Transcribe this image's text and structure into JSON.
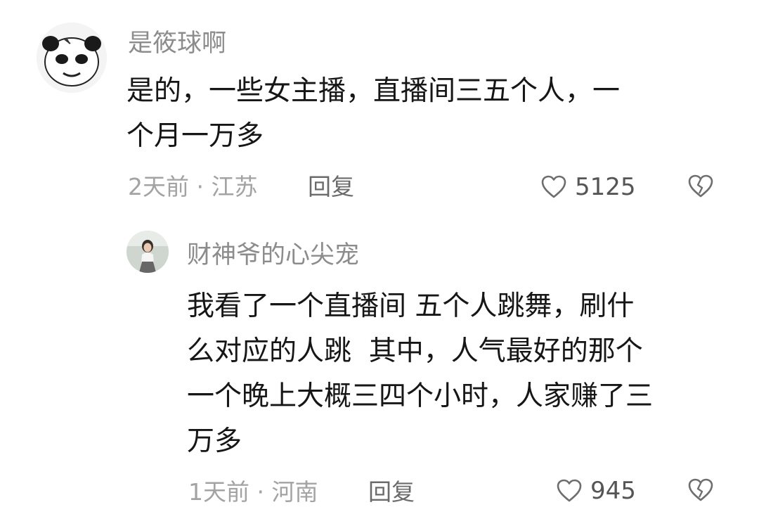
{
  "comments": [
    {
      "username": "是筱球啊",
      "content": "是的，一些女主播，直播间三五个人，一\n个月一万多",
      "meta": "2天前 · 江苏",
      "reply_label": "回复",
      "likes": "5125",
      "avatar_icon": "panda-meme-avatar"
    },
    {
      "username": "财神爷的心尖宠",
      "content": "我看了一个直播间 五个人跳舞，刷什\n么对应的人跳  其中，人气最好的那个\n一个晚上大概三四个小时，人家赚了三\n万多",
      "meta": "1天前 · 河南",
      "reply_label": "回复",
      "likes": "945",
      "avatar_icon": "photo-avatar"
    }
  ],
  "colors": {
    "username": "#8c8c8c",
    "content": "#161616",
    "meta": "#a3a3a3",
    "icon": "#6e6e6e"
  }
}
